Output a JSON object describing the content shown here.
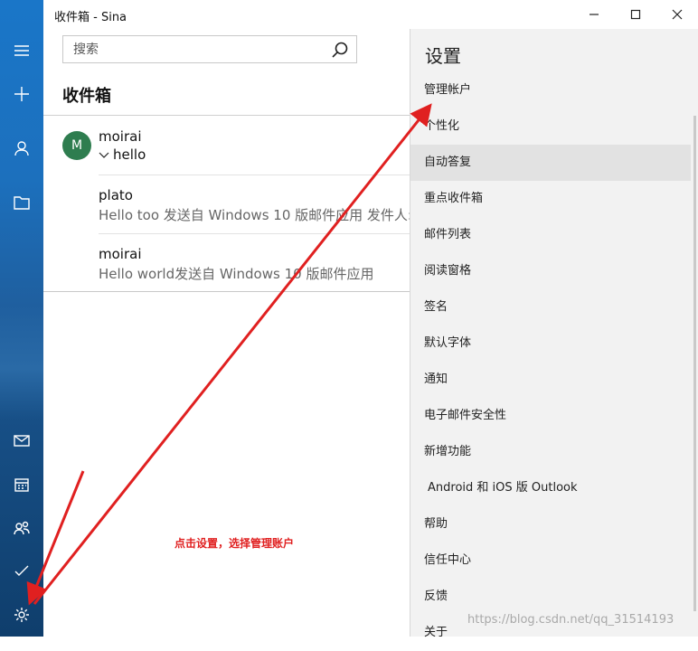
{
  "window": {
    "title": "收件箱 - Sina",
    "controls": [
      "minimize-icon",
      "maximize-icon",
      "close-icon"
    ]
  },
  "rail": {
    "top_icons": [
      "hamburger-menu-icon",
      "new-mail-plus-icon",
      "account-person-icon",
      "folder-icon"
    ],
    "bottom_icons": [
      "mail-icon",
      "calendar-icon",
      "people-icon",
      "todo-check-icon",
      "settings-gear-icon"
    ]
  },
  "search": {
    "placeholder": "搜索"
  },
  "folder": {
    "title": "收件箱"
  },
  "messages": [
    {
      "avatar_letter": "M",
      "sender": "moirai",
      "subject": "hello",
      "preview": ""
    },
    {
      "sender": "plato",
      "preview": "Hello too 发送自 Windows 10 版邮件应用 发件人:"
    },
    {
      "sender": "moirai",
      "preview": "Hello world发送自 Windows 10 版邮件应用"
    }
  ],
  "settings": {
    "title": "设置",
    "items": [
      "管理帐户",
      "个性化",
      "自动答复",
      "重点收件箱",
      "邮件列表",
      "阅读窗格",
      "签名",
      "默认字体",
      "通知",
      "电子邮件安全性",
      "新增功能",
      "Android 和 iOS 版 Outlook",
      "帮助",
      "信任中心",
      "反馈",
      "关于"
    ],
    "highlighted_index": 2
  },
  "annotation": {
    "text": "点击设置，选择管理账户",
    "color": "#e02020"
  },
  "watermark": {
    "text": "https://blog.csdn.net/qq_31514193"
  },
  "colors": {
    "rail_accent": "#1a76c8",
    "avatar": "#2e7d4f",
    "arrow": "#e02020"
  }
}
